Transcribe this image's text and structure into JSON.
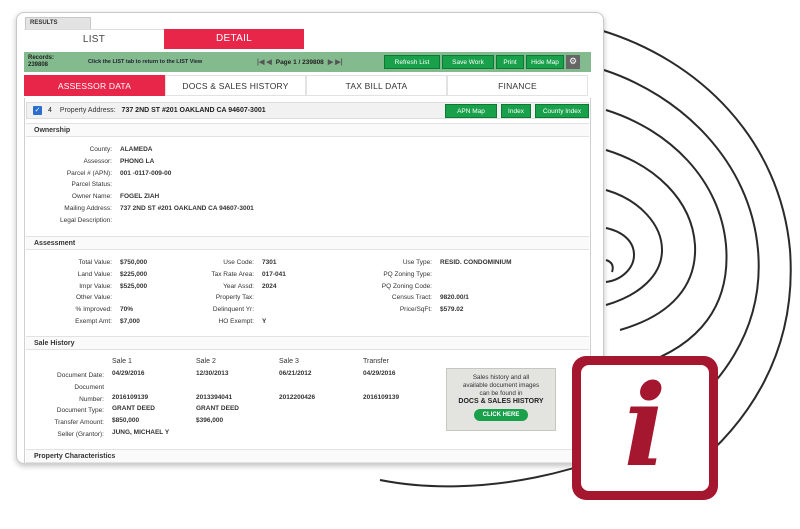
{
  "results_tab": "RESULTS",
  "top_tabs": {
    "list": "LIST",
    "detail": "DETAIL"
  },
  "toolbar": {
    "records_label": "Records:",
    "records_count": "239808",
    "hint": "Click the LIST tab to return to the LIST View",
    "page_text": "Page 1 / 239808",
    "refresh_list": "Refresh List",
    "save_work": "Save Work",
    "print": "Print",
    "hide_map": "Hide Map"
  },
  "section_tabs": [
    "ASSESSOR DATA",
    "DOCS & SALES HISTORY",
    "TAX BILL DATA",
    "FINANCE"
  ],
  "property_bar": {
    "number": "4",
    "label": "Property Address:",
    "address": "737 2ND ST #201 OAKLAND CA 94607-3001",
    "apn_map": "APN Map",
    "index": "Index",
    "county_index": "County Index"
  },
  "ownership": {
    "title": "Ownership",
    "rows": [
      {
        "label": "County:",
        "value": "ALAMEDA"
      },
      {
        "label": "Assessor:",
        "value": "PHONG LA"
      },
      {
        "label": "Parcel # (APN):",
        "value": "001 -0117-009-00"
      },
      {
        "label": "Parcel Status:",
        "value": ""
      },
      {
        "label": "Owner Name:",
        "value": "FOGEL ZIAH"
      },
      {
        "label": "Mailing Address:",
        "value": "737 2ND ST #201 OAKLAND CA 94607-3001"
      },
      {
        "label": "Legal Description:",
        "value": ""
      }
    ]
  },
  "assessment": {
    "title": "Assessment",
    "col1": [
      {
        "label": "Total Value:",
        "value": "$750,000"
      },
      {
        "label": "Land Value:",
        "value": "$225,000"
      },
      {
        "label": "Impr Value:",
        "value": "$525,000"
      },
      {
        "label": "Other Value:",
        "value": ""
      },
      {
        "label": "% Improved:",
        "value": "70%"
      },
      {
        "label": "Exempt Amt:",
        "value": "$7,000"
      }
    ],
    "col2": [
      {
        "label": "Use Code:",
        "value": "7301"
      },
      {
        "label": "Tax Rate Area:",
        "value": "017-041"
      },
      {
        "label": "Year Assd:",
        "value": "2024"
      },
      {
        "label": "Property Tax:",
        "value": ""
      },
      {
        "label": "Delinquent Yr:",
        "value": ""
      },
      {
        "label": "HO Exempt:",
        "value": "Y"
      }
    ],
    "col3": [
      {
        "label": "Use Type:",
        "value": "RESID. CONDOMINIUM"
      },
      {
        "label": "PQ Zoning Type:",
        "value": ""
      },
      {
        "label": "PQ Zoning Code:",
        "value": ""
      },
      {
        "label": "Census Tract:",
        "value": "9820.00/1"
      },
      {
        "label": "Price/SqFt:",
        "value": "$579.02"
      }
    ]
  },
  "sale_history": {
    "title": "Sale History",
    "labels": [
      "Document Date:",
      "Document",
      "Number:",
      "Document Type:",
      "Transfer Amount:",
      "Seller (Grantor):"
    ],
    "columns": [
      {
        "header": "Sale 1",
        "date": "04/29/2016",
        "number": "2016109139",
        "type": "GRANT DEED",
        "amount": "$850,000",
        "seller": "JUNG, MICHAEL Y"
      },
      {
        "header": "Sale 2",
        "date": "12/30/2013",
        "number": "2013394041",
        "type": "GRANT DEED",
        "amount": "$396,000",
        "seller": ""
      },
      {
        "header": "Sale 3",
        "date": "06/21/2012",
        "number": "2012200426",
        "type": "",
        "amount": "",
        "seller": ""
      },
      {
        "header": "Transfer",
        "date": "04/29/2016",
        "number": "2016109139",
        "type": "",
        "amount": "",
        "seller": ""
      }
    ],
    "note_line1": "Sales history and all",
    "note_line2": "available document images",
    "note_line3": "can be found in",
    "note_strong": "DOCS & SALES HISTORY",
    "click_here": "CLICK HERE"
  },
  "property_characteristics": {
    "title": "Property Characteristics"
  },
  "info_badge": {
    "glyph": "i",
    "icon": "info-icon",
    "color": "#a5162f"
  },
  "colors": {
    "accent_red": "#e8264a",
    "button_green": "#18a04a",
    "toolbar_green": "#84bb8e"
  }
}
